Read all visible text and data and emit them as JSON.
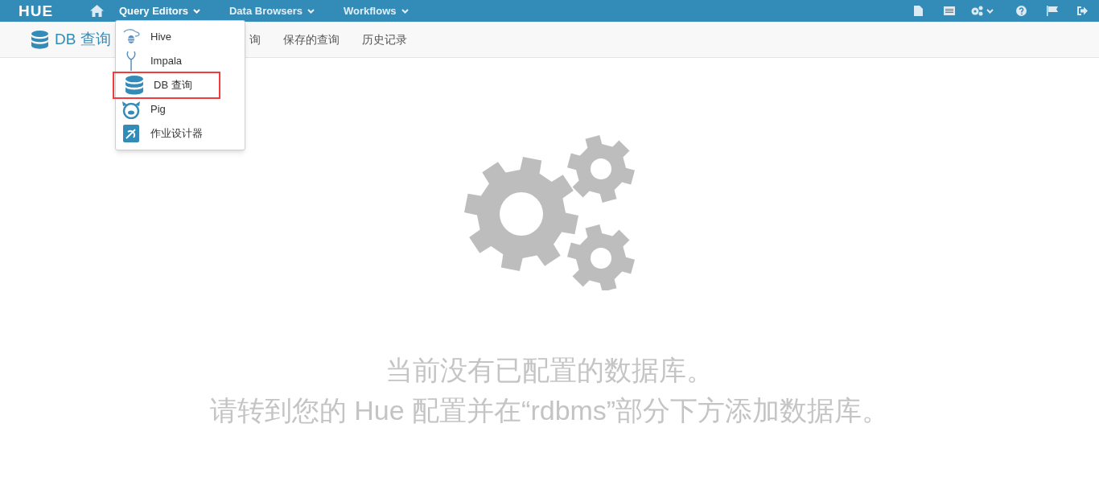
{
  "navbar": {
    "logo": "HUE",
    "menus": [
      {
        "label": "Query Editors",
        "selected": true
      },
      {
        "label": "Data Browsers",
        "selected": false
      },
      {
        "label": "Workflows",
        "selected": false
      }
    ]
  },
  "dropdown": {
    "items": [
      {
        "kind": "hive",
        "label": "Hive",
        "highlighted": false
      },
      {
        "kind": "impala",
        "label": "Impala",
        "highlighted": false
      },
      {
        "kind": "db",
        "label": "DB 查询",
        "highlighted": true
      },
      {
        "kind": "pig",
        "label": "Pig",
        "highlighted": false
      },
      {
        "kind": "designer",
        "label": "作业设计器",
        "highlighted": false
      }
    ]
  },
  "subnav": {
    "title": "DB 查询",
    "items": [
      "询",
      "保存的查询",
      "历史记录"
    ]
  },
  "message": {
    "lines": [
      "当前没有已配置的数据库。",
      "请转到您的 Hue 配置并在“rdbms”部分下方添加数据库。"
    ]
  }
}
